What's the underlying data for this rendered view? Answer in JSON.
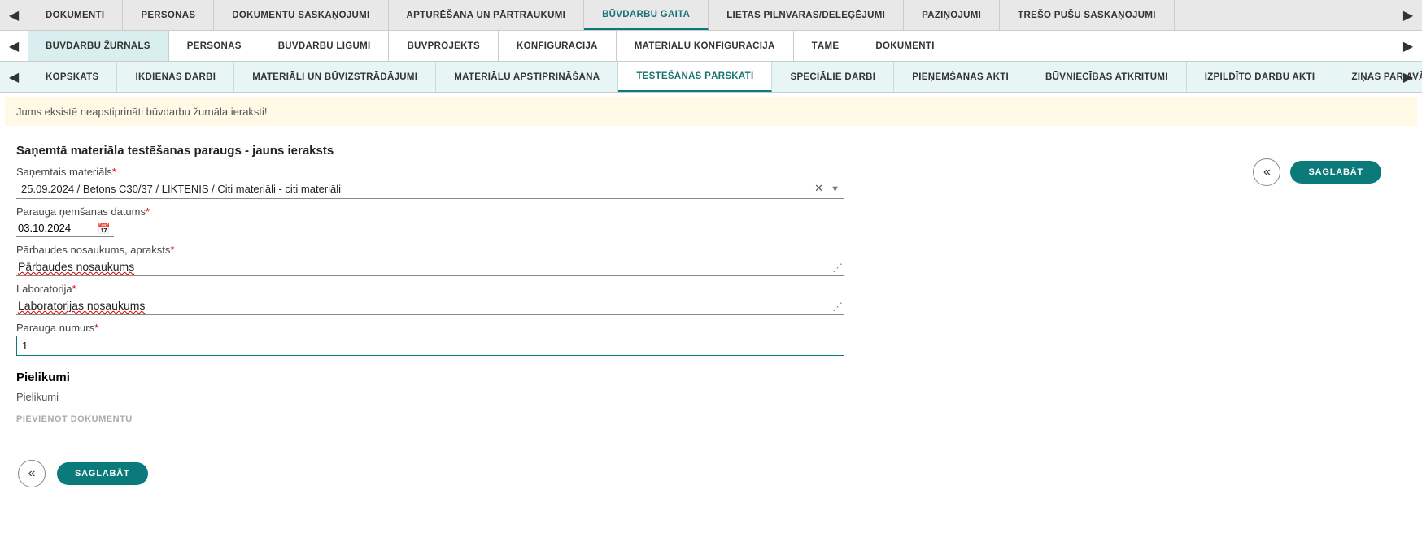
{
  "navTop": [
    "Dokumenti",
    "Personas",
    "Dokumentu saskaņojumi",
    "Apturēšana un pārtraukumi",
    "Būvdarbu gaita",
    "Lietas pilnvaras/deleģējumi",
    "Paziņojumi",
    "Trešo pušu saskaņojumi"
  ],
  "navTopActive": 4,
  "navSub": [
    "Būvdarbu žurnāls",
    "Personas",
    "Būvdarbu līgumi",
    "Būvprojekts",
    "Konfigurācija",
    "Materiālu konfigurācija",
    "Tāme",
    "Dokumenti"
  ],
  "navSubActive": 0,
  "navSub2": [
    "Kopskats",
    "Ikdienas darbi",
    "Materiāli un būvizstrādājumi",
    "Materiālu apstiprināšana",
    "Testēšanas pārskati",
    "Speciālie darbi",
    "Pieņemšanas akti",
    "Būvniecības atkritumi",
    "Izpildīto darbu akti",
    "Ziņas par avāriju vai nelaime"
  ],
  "navSub2Active": 4,
  "notice": "Jums eksistē neapstiprināti būvdarbu žurnāla ieraksti!",
  "form": {
    "title": "Saņemtā materiāla testēšanas paraugs - jauns ieraksts",
    "materialLabel": "Saņemtais materiāls",
    "materialValue": "25.09.2024 / Betons C30/37 / LIKTENIS / Citi materiāli - citi materiāli",
    "dateLabel": "Parauga ņemšanas datums",
    "dateValue": "03.10.2024",
    "testNameLabel": "Pārbaudes nosaukums, apraksts",
    "testNameValue": "Pārbaudes nosaukums",
    "labLabel": "Laboratorija",
    "labValue": "Laboratorijas nosaukums",
    "sampleNoLabel": "Parauga numurs",
    "sampleNoValue": "1",
    "attachmentsTitle": "Pielikumi",
    "attachmentsLabel": "Pielikumi",
    "addDocLabel": "Pievienot dokumentu",
    "saveLabel": "Saglabāt"
  }
}
